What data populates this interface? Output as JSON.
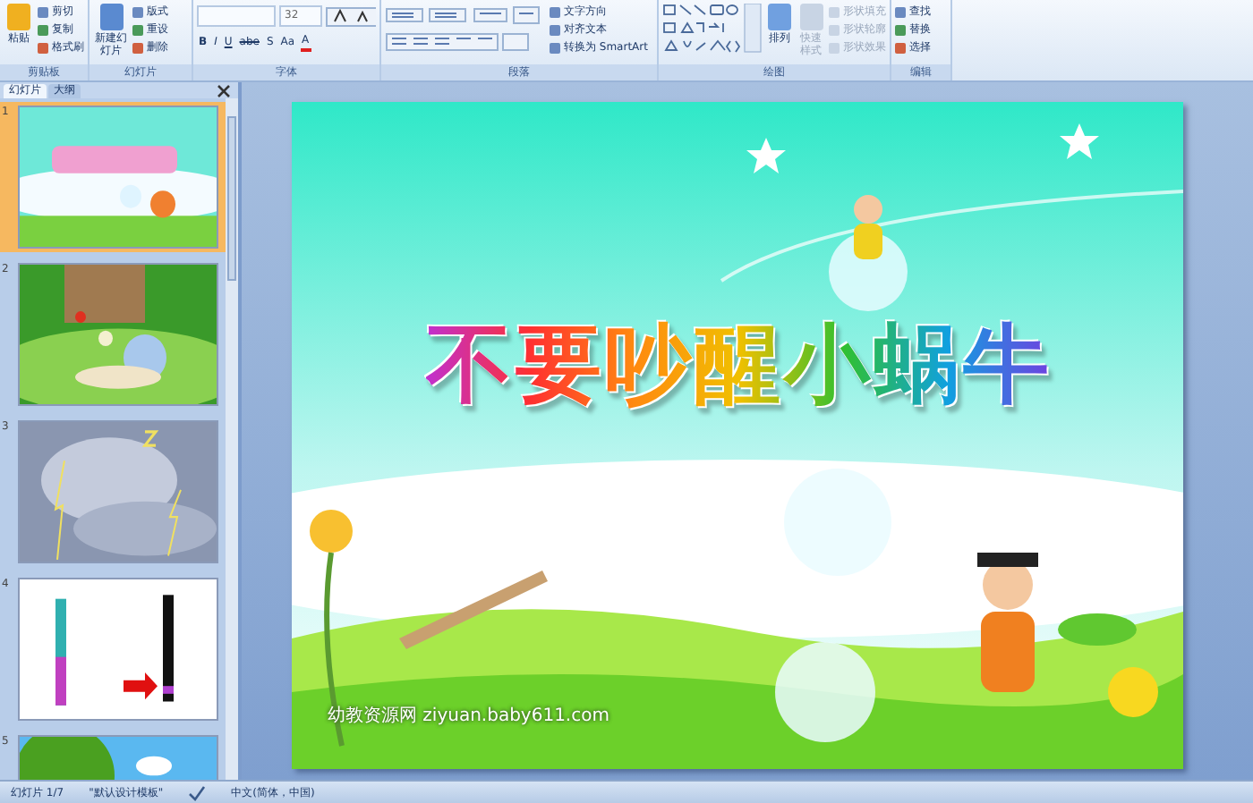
{
  "ribbon": {
    "groups": [
      {
        "label": "剪贴板",
        "kind": "buttons",
        "big": [
          {
            "label": "粘贴",
            "disabled": false
          }
        ],
        "small": [
          {
            "label": "剪切",
            "disabled": false
          },
          {
            "label": "复制",
            "disabled": false
          },
          {
            "label": "格式刷",
            "disabled": false
          }
        ]
      },
      {
        "label": "幻灯片",
        "kind": "buttons",
        "big": [
          {
            "label": "新建幻灯片",
            "disabled": false
          }
        ],
        "small": [
          {
            "label": "版式",
            "disabled": false
          },
          {
            "label": "重设",
            "disabled": false
          },
          {
            "label": "删除",
            "disabled": false
          }
        ]
      },
      {
        "label": "字体",
        "kind": "font",
        "font_size": "32",
        "format_buttons": [
          "B",
          "I",
          "U",
          "abe",
          "S",
          "Aa",
          "A"
        ]
      },
      {
        "label": "段落",
        "kind": "paragraph",
        "small": [
          {
            "label": "文字方向",
            "disabled": false
          },
          {
            "label": "对齐文本",
            "disabled": false
          },
          {
            "label": "转换为 SmartArt",
            "disabled": false
          }
        ]
      },
      {
        "label": "绘图",
        "kind": "drawing",
        "big": [
          {
            "label": "排列",
            "disabled": false
          },
          {
            "label": "快速样式",
            "disabled": true
          }
        ],
        "small": [
          {
            "label": "形状填充",
            "disabled": true
          },
          {
            "label": "形状轮廓",
            "disabled": true
          },
          {
            "label": "形状效果",
            "disabled": true
          }
        ]
      },
      {
        "label": "编辑",
        "kind": "buttons",
        "small": [
          {
            "label": "查找",
            "disabled": false
          },
          {
            "label": "替换",
            "disabled": false
          },
          {
            "label": "选择",
            "disabled": false
          }
        ]
      }
    ]
  },
  "panel": {
    "tabs": [
      {
        "label": "幻灯片",
        "selected": true
      },
      {
        "label": "大纲",
        "selected": false
      }
    ],
    "thumbnails": [
      {
        "number": "1",
        "selected": true
      },
      {
        "number": "2",
        "selected": false
      },
      {
        "number": "3",
        "selected": false
      },
      {
        "number": "4",
        "selected": false
      },
      {
        "number": "5",
        "selected": false
      }
    ]
  },
  "slide": {
    "title": "不要吵醒小蜗牛",
    "footer": "幼教资源网 ziyuan.baby611.com"
  },
  "status_bar": {
    "slide_count": "幻灯片 1/7",
    "theme": "\"默认设计模板\"",
    "language": "中文(简体，中国)"
  }
}
